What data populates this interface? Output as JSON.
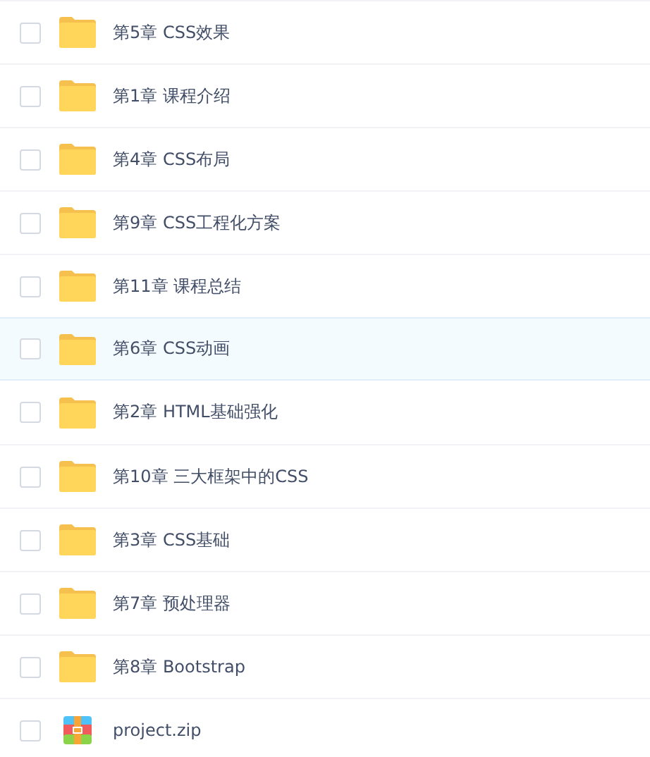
{
  "files": [
    {
      "kind": "folder",
      "name": "第5章 CSS效果",
      "checked": false,
      "highlighted": false
    },
    {
      "kind": "folder",
      "name": "第1章 课程介绍",
      "checked": false,
      "highlighted": false
    },
    {
      "kind": "folder",
      "name": "第4章 CSS布局",
      "checked": false,
      "highlighted": false
    },
    {
      "kind": "folder",
      "name": "第9章 CSS工程化方案",
      "checked": false,
      "highlighted": false
    },
    {
      "kind": "folder",
      "name": "第11章 课程总结",
      "checked": false,
      "highlighted": false
    },
    {
      "kind": "folder",
      "name": "第6章 CSS动画",
      "checked": false,
      "highlighted": true
    },
    {
      "kind": "folder",
      "name": "第2章 HTML基础强化",
      "checked": false,
      "highlighted": false
    },
    {
      "kind": "folder",
      "name": "第10章 三大框架中的CSS",
      "checked": false,
      "highlighted": false
    },
    {
      "kind": "folder",
      "name": "第3章 CSS基础",
      "checked": false,
      "highlighted": false
    },
    {
      "kind": "folder",
      "name": "第7章 预处理器",
      "checked": false,
      "highlighted": false
    },
    {
      "kind": "folder",
      "name": "第8章 Bootstrap",
      "checked": false,
      "highlighted": false
    },
    {
      "kind": "zip",
      "name": "project.zip",
      "checked": false,
      "highlighted": false
    }
  ]
}
